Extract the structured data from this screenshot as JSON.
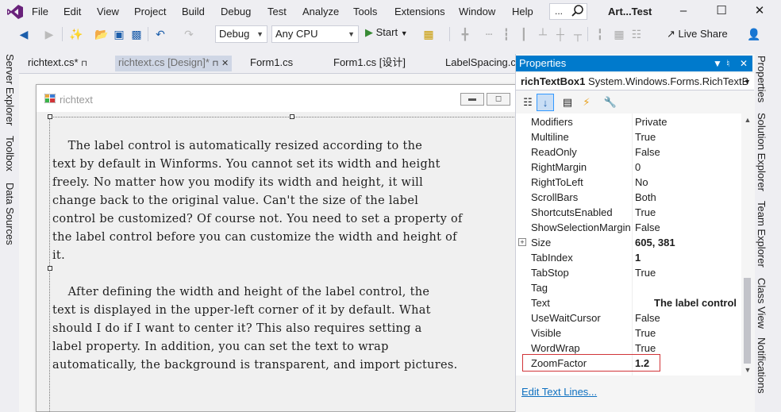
{
  "menu": {
    "items": [
      "File",
      "Edit",
      "View",
      "Project",
      "Build",
      "Debug",
      "Test",
      "Analyze",
      "Tools",
      "Extensions",
      "Window",
      "Help"
    ],
    "search_placeholder": "...",
    "title": "Art...Test"
  },
  "toolbar": {
    "config": "Debug",
    "platform": "Any CPU",
    "start_label": "Start",
    "live_share": "Live Share"
  },
  "left_rail": [
    "Server Explorer",
    "Toolbox",
    "Data Sources"
  ],
  "right_rail": [
    "Properties",
    "Solution Explorer",
    "Team Explorer",
    "Class View",
    "Notifications"
  ],
  "tabs": [
    {
      "label": "richtext.cs*",
      "pin": "⊓"
    },
    {
      "label": "richtext.cs [Design]*",
      "pin": "⊓",
      "close": "✕"
    },
    {
      "label": "Form1.cs"
    },
    {
      "label": "Form1.cs [设计]"
    },
    {
      "label": "LabelSpacing.c"
    }
  ],
  "designer": {
    "form_title": "richtext",
    "lines": [
      "",
      "    The label control is automatically resized according to the",
      "text by default in Winforms. You cannot set its width and height",
      "freely. No matter how you modify its width and height, it will",
      "change back to the original value. Can't the size of the label",
      "control be customized? Of course not. You need to set a property of",
      "the label control before you can customize the width and height of",
      "it.",
      "",
      "    After defining the width and height of the label control, the",
      "text is displayed in the upper-left corner of it by default. What",
      "should I do if I want to center it? This also requires setting a",
      "label property. In addition, you can set the text to wrap",
      "automatically, the background is transparent, and import pictures."
    ]
  },
  "properties": {
    "title": "Properties",
    "object_name": "richTextBox1",
    "object_type": "System.Windows.Forms.RichTextB",
    "rows": [
      {
        "name": "Modifiers",
        "value": "Private"
      },
      {
        "name": "Multiline",
        "value": "True"
      },
      {
        "name": "ReadOnly",
        "value": "False"
      },
      {
        "name": "RightMargin",
        "value": "0"
      },
      {
        "name": "RightToLeft",
        "value": "No"
      },
      {
        "name": "ScrollBars",
        "value": "Both"
      },
      {
        "name": "ShortcutsEnabled",
        "value": "True"
      },
      {
        "name": "ShowSelectionMargin",
        "value": "False"
      },
      {
        "name": "Size",
        "value": "605, 381",
        "bold": true,
        "expandable": true
      },
      {
        "name": "TabIndex",
        "value": "1",
        "bold": true
      },
      {
        "name": "TabStop",
        "value": "True"
      },
      {
        "name": "Tag",
        "value": ""
      },
      {
        "name": "Text",
        "value": "The label control",
        "bold": true
      },
      {
        "name": "UseWaitCursor",
        "value": "False"
      },
      {
        "name": "Visible",
        "value": "True"
      },
      {
        "name": "WordWrap",
        "value": "True"
      },
      {
        "name": "ZoomFactor",
        "value": "1.2",
        "bold": true,
        "highlighted": true
      }
    ],
    "edit_link": "Edit Text Lines..."
  },
  "colors": {
    "accent": "#007acc",
    "highlight_border": "#d13438",
    "link": "#0e70c0"
  }
}
